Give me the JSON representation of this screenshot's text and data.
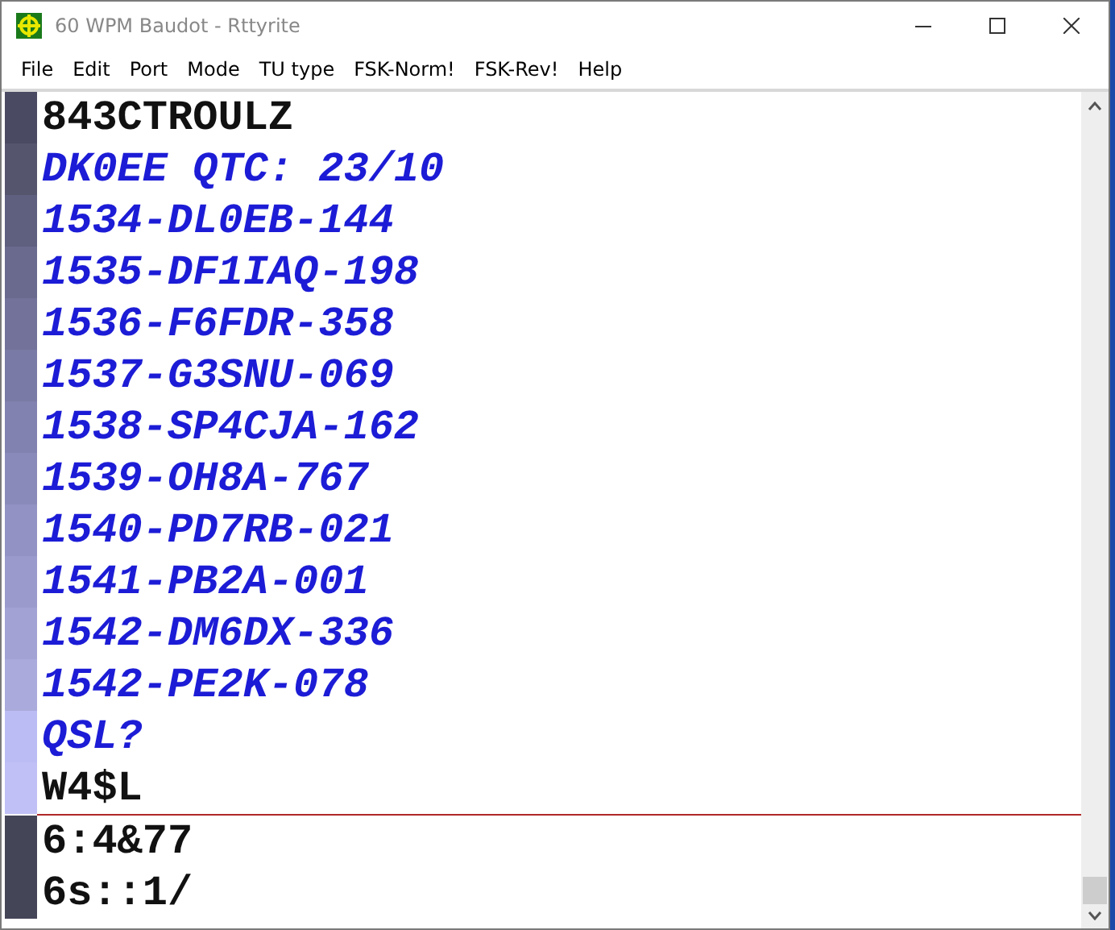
{
  "window": {
    "title": "60 WPM Baudot - Rttyrite"
  },
  "menu": [
    "File",
    "Edit",
    "Port",
    "Mode",
    "TU type",
    "FSK-Norm!",
    "FSK-Rev!",
    "Help"
  ],
  "receive_pane": {
    "lines": [
      {
        "text": "843CTROULZ",
        "kind": "received",
        "color": "#4a4a62"
      },
      {
        "text": "DK0EE QTC: 23/10",
        "kind": "sent",
        "color": "#55556e"
      },
      {
        "text": "1534-DL0EB-144",
        "kind": "sent",
        "color": "#5f5f80"
      },
      {
        "text": "1535-DF1IAQ-198",
        "kind": "sent",
        "color": "#6a6a8e"
      },
      {
        "text": "1536-F6FDR-358",
        "kind": "sent",
        "color": "#72729a"
      },
      {
        "text": "1537-G3SNU-069",
        "kind": "sent",
        "color": "#7a7aa6"
      },
      {
        "text": "1538-SP4CJA-162",
        "kind": "sent",
        "color": "#8282b0"
      },
      {
        "text": "1539-OH8A-767",
        "kind": "sent",
        "color": "#8a8aba"
      },
      {
        "text": "1540-PD7RB-021",
        "kind": "sent",
        "color": "#9292c4"
      },
      {
        "text": "1541-PB2A-001",
        "kind": "sent",
        "color": "#9a9acc"
      },
      {
        "text": "1542-DM6DX-336",
        "kind": "sent",
        "color": "#a2a2d4"
      },
      {
        "text": "1542-PE2K-078",
        "kind": "sent",
        "color": "#aaaadc"
      },
      {
        "text": "QSL?",
        "kind": "sent",
        "color": "#bcbcf4"
      },
      {
        "text": "W4$L",
        "kind": "received",
        "color": "#c0c0f6"
      }
    ]
  },
  "transmit_pane": {
    "lines": [
      {
        "text": "6:4&77",
        "kind": "received",
        "color": "#454558"
      },
      {
        "text": "6s::1/",
        "kind": "received",
        "color": "#454558"
      }
    ]
  }
}
